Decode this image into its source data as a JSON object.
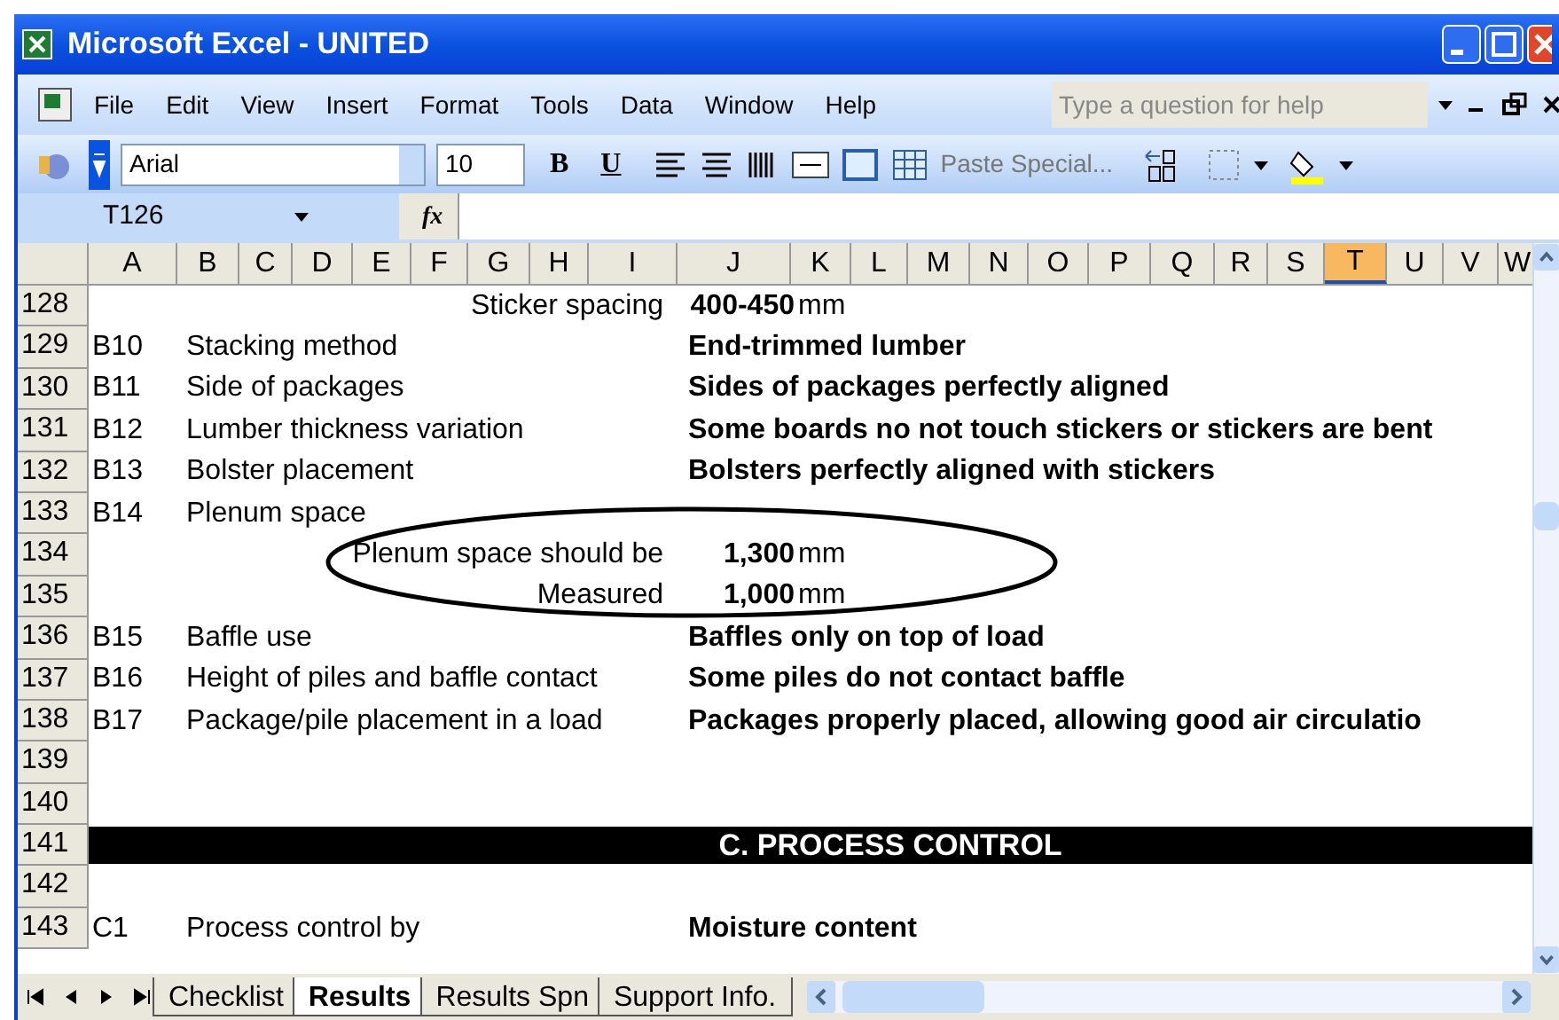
{
  "window": {
    "title": "Microsoft Excel - UNITED"
  },
  "menu": [
    "File",
    "Edit",
    "View",
    "Insert",
    "Format",
    "Tools",
    "Data",
    "Window",
    "Help"
  ],
  "help_box": {
    "placeholder": "Type a question for help"
  },
  "toolbar": {
    "font": "Arial",
    "size": "10",
    "bold": "B",
    "underline": "U",
    "paste_special": "Paste Special..."
  },
  "formula_bar": {
    "name_box": "T126",
    "fx": "fx"
  },
  "columns": [
    {
      "label": "A",
      "selected": false
    },
    {
      "label": "B",
      "selected": false
    },
    {
      "label": "C",
      "selected": false
    },
    {
      "label": "D",
      "selected": false
    },
    {
      "label": "E",
      "selected": false
    },
    {
      "label": "F",
      "selected": false
    },
    {
      "label": "G",
      "selected": false
    },
    {
      "label": "H",
      "selected": false
    },
    {
      "label": "I",
      "selected": false
    },
    {
      "label": "J",
      "selected": false
    },
    {
      "label": "K",
      "selected": false
    },
    {
      "label": "L",
      "selected": false
    },
    {
      "label": "M",
      "selected": false
    },
    {
      "label": "N",
      "selected": false
    },
    {
      "label": "O",
      "selected": false
    },
    {
      "label": "P",
      "selected": false
    },
    {
      "label": "Q",
      "selected": false
    },
    {
      "label": "R",
      "selected": false
    },
    {
      "label": "S",
      "selected": false
    },
    {
      "label": "T",
      "selected": true
    },
    {
      "label": "U",
      "selected": false
    },
    {
      "label": "V",
      "selected": false
    },
    {
      "label": "W",
      "selected": false
    }
  ],
  "rows": [
    {
      "number": "128",
      "kind": "measure",
      "label": "Sticker spacing",
      "value": "400-450",
      "unit": "mm"
    },
    {
      "number": "129",
      "kind": "item",
      "code": "B10",
      "label": "Stacking method",
      "answer": "End-trimmed lumber"
    },
    {
      "number": "130",
      "kind": "item",
      "code": "B11",
      "label": "Side of packages",
      "answer": "Sides of packages perfectly aligned"
    },
    {
      "number": "131",
      "kind": "item",
      "code": "B12",
      "label": "Lumber thickness variation",
      "answer": "Some boards no not touch stickers or stickers are bent"
    },
    {
      "number": "132",
      "kind": "item",
      "code": "B13",
      "label": "Bolster placement",
      "answer": "Bolsters perfectly aligned with stickers"
    },
    {
      "number": "133",
      "kind": "item",
      "code": "B14",
      "label": "Plenum space"
    },
    {
      "number": "134",
      "kind": "measure",
      "label": "Plenum space should be",
      "value": "1,300",
      "unit": "mm"
    },
    {
      "number": "135",
      "kind": "measure",
      "label": "Measured",
      "value": "1,000",
      "unit": "mm"
    },
    {
      "number": "136",
      "kind": "item",
      "code": "B15",
      "label": "Baffle use",
      "answer": "Baffles only on top of load"
    },
    {
      "number": "137",
      "kind": "item",
      "code": "B16",
      "label": "Height of piles and baffle contact",
      "answer": "Some piles do not contact baffle"
    },
    {
      "number": "138",
      "kind": "item",
      "code": "B17",
      "label": "Package/pile placement in a load",
      "answer": "Packages properly placed, allowing good air circulatio"
    },
    {
      "number": "139",
      "kind": "blank"
    },
    {
      "number": "140",
      "kind": "blank"
    },
    {
      "number": "141",
      "kind": "section",
      "title": "C. PROCESS CONTROL"
    },
    {
      "number": "142",
      "kind": "blank"
    },
    {
      "number": "143",
      "kind": "item",
      "code": "C1",
      "label": "Process control by",
      "answer": "Moisture content"
    }
  ],
  "sheet_tabs": [
    {
      "label": "Checklist",
      "selected": false
    },
    {
      "label": "Results",
      "selected": true
    },
    {
      "label": "Results Spn",
      "selected": false
    },
    {
      "label": "Support Info.",
      "selected": false
    }
  ]
}
